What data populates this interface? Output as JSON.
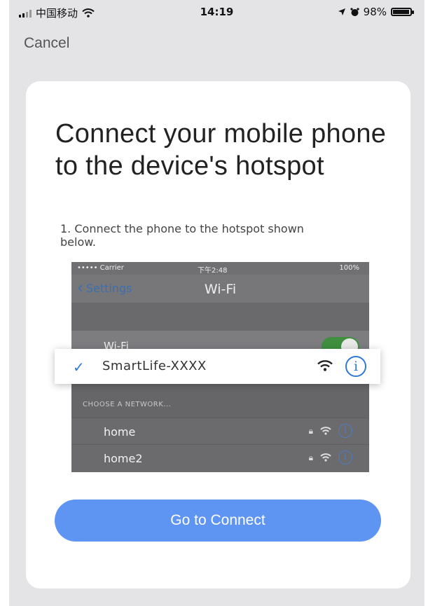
{
  "status_bar": {
    "carrier": "中国移动",
    "time": "14:19",
    "battery": "98%",
    "battery_level": 0.98
  },
  "header": {
    "cancel_label": "Cancel"
  },
  "card": {
    "title": "Connect your mobile phone to the device's hotspot",
    "step_text": "1. Connect the phone to the hotspot shown below."
  },
  "illustration": {
    "status": {
      "carrier": "••••• Carrier",
      "time": "下午2:48",
      "battery": "100%"
    },
    "nav": {
      "back_label": "Settings",
      "title": "Wi-Fi"
    },
    "wifi_label": "Wi-Fi",
    "wifi_enabled": true,
    "selected_network": "SmartLife-XXXX",
    "section_header": "CHOOSE A NETWORK...",
    "networks": [
      {
        "name": "home"
      },
      {
        "name": "home2"
      }
    ]
  },
  "cta": {
    "label": "Go to Connect"
  },
  "colors": {
    "accent": "#5f95f2",
    "check": "#2d7ad6",
    "toggle_on": "#3f8f3f"
  }
}
